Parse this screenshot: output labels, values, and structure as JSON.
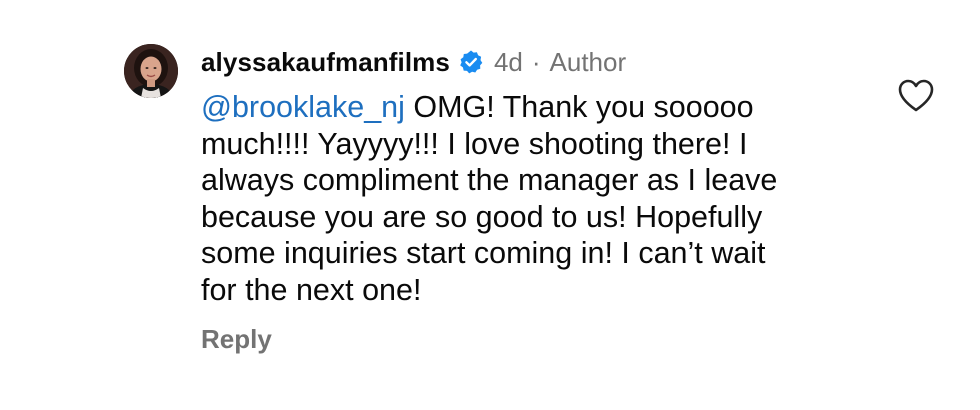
{
  "comment": {
    "username": "alyssakaufmanfilms",
    "verified": true,
    "time": "4d",
    "separator": "·",
    "role": "Author",
    "mention": "@brooklake_nj",
    "lines": [
      " OMG! Thank you sooooo",
      "much!!!! Yayyyy!!! I love shooting there! I",
      "always compliment the manager as I leave",
      "because you are so good to us! Hopefully",
      "some inquiries start coming in! I can’t wait",
      "for the next one!"
    ],
    "reply_label": "Reply",
    "like_icon": "heart-outline-icon",
    "verified_icon": "verified-badge-icon"
  },
  "colors": {
    "mention": "#1e6fbf",
    "meta": "#737373",
    "verified": "#1a8cf1"
  }
}
